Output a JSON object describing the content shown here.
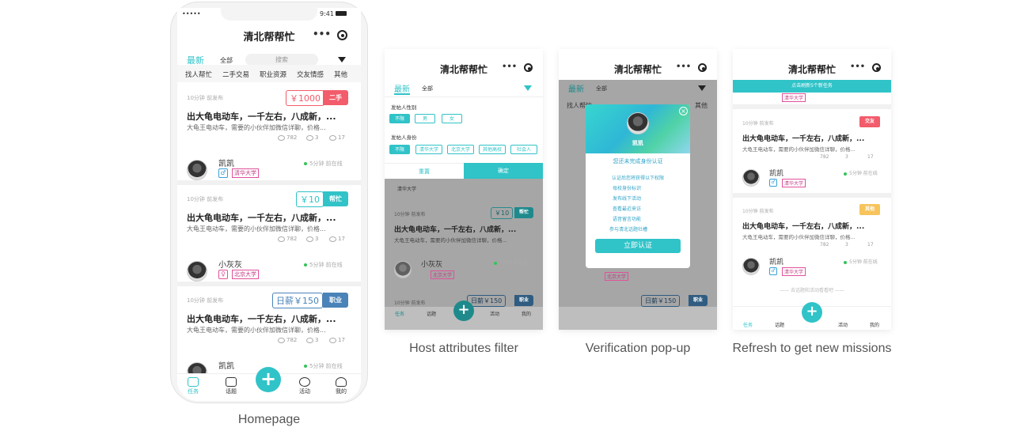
{
  "app": {
    "title": "清北帮帮忙",
    "dots": "•••",
    "status_time": "9:41",
    "status_signal": "•••••",
    "tab_latest": "最新",
    "tab_all": "全部",
    "search_placeholder": "搜索",
    "categories": [
      "找人帮忙",
      "二手交易",
      "职业资源",
      "交友情感",
      "其他"
    ]
  },
  "posts": [
    {
      "time": "10分钟 前发布",
      "price": "￥1000",
      "tag": "二手",
      "title": "出大龟电动车，一千左右，八成新，...",
      "desc": "大龟王电动车，需要的小伙伴加微信详聊，价格...",
      "views": "782",
      "comments": "3",
      "likes": "17",
      "user": "凯凯",
      "gender": "♂",
      "school": "清华大学",
      "online": "5分钟 前在线"
    },
    {
      "time": "10分钟 前发布",
      "price": "￥10",
      "tag": "帮忙",
      "title": "出大龟电动车，一千左右，八成新，...",
      "desc": "大龟王电动车，需要的小伙伴加微信详聊，价格...",
      "views": "782",
      "comments": "3",
      "likes": "17",
      "user": "小灰灰",
      "gender": "♀",
      "school": "北京大学",
      "online": "5分钟 前在线"
    },
    {
      "time": "10分钟 前发布",
      "price": "日薪￥150",
      "tag": "职业",
      "title": "出大龟电动车，一千左右，八成新，...",
      "desc": "大龟王电动车，需要的小伙伴加微信详聊，价格...",
      "views": "782",
      "comments": "3",
      "likes": "17",
      "user": "凯凯",
      "gender": "♂",
      "school": "清华大学",
      "online": "5分钟 前在线"
    }
  ],
  "tabbar": [
    "任务",
    "话题",
    "活动",
    "我的"
  ],
  "fab": "+",
  "filter": {
    "gender_label": "发帖人性别",
    "gender_opts": [
      "不限",
      "男",
      "女"
    ],
    "identity_label": "发帖人身份",
    "identity_opts": [
      "不限",
      "清华大学",
      "北京大学",
      "其他高校",
      "社会人"
    ],
    "reset": "重置",
    "confirm": "确定"
  },
  "verify": {
    "user": "凯凯",
    "heading": "您还未完成身份认证",
    "sub": "认证后您将获得以下权限",
    "perms": [
      "母校身份标识",
      "发布线下活动",
      "查看最近来访",
      "语音留言功能",
      "参与清北话题社槽"
    ],
    "button": "立即认证"
  },
  "refresh": {
    "banner": "点击刷新5个新任务",
    "footer": "—— 去话题和活动看看吧 ——",
    "tags": [
      "交友",
      "其他"
    ]
  },
  "captions": [
    "Homepage",
    "Host attributes filter",
    "Verification pop-up",
    "Refresh to get new missions"
  ],
  "colors": {
    "accent": "#30c3c8",
    "tag_secondhand": "#f25c6b",
    "tag_help": "#30c3c8",
    "tag_job": "#4a83b8",
    "tag_friend": "#f25c6b",
    "tag_other": "#f7c45c"
  }
}
